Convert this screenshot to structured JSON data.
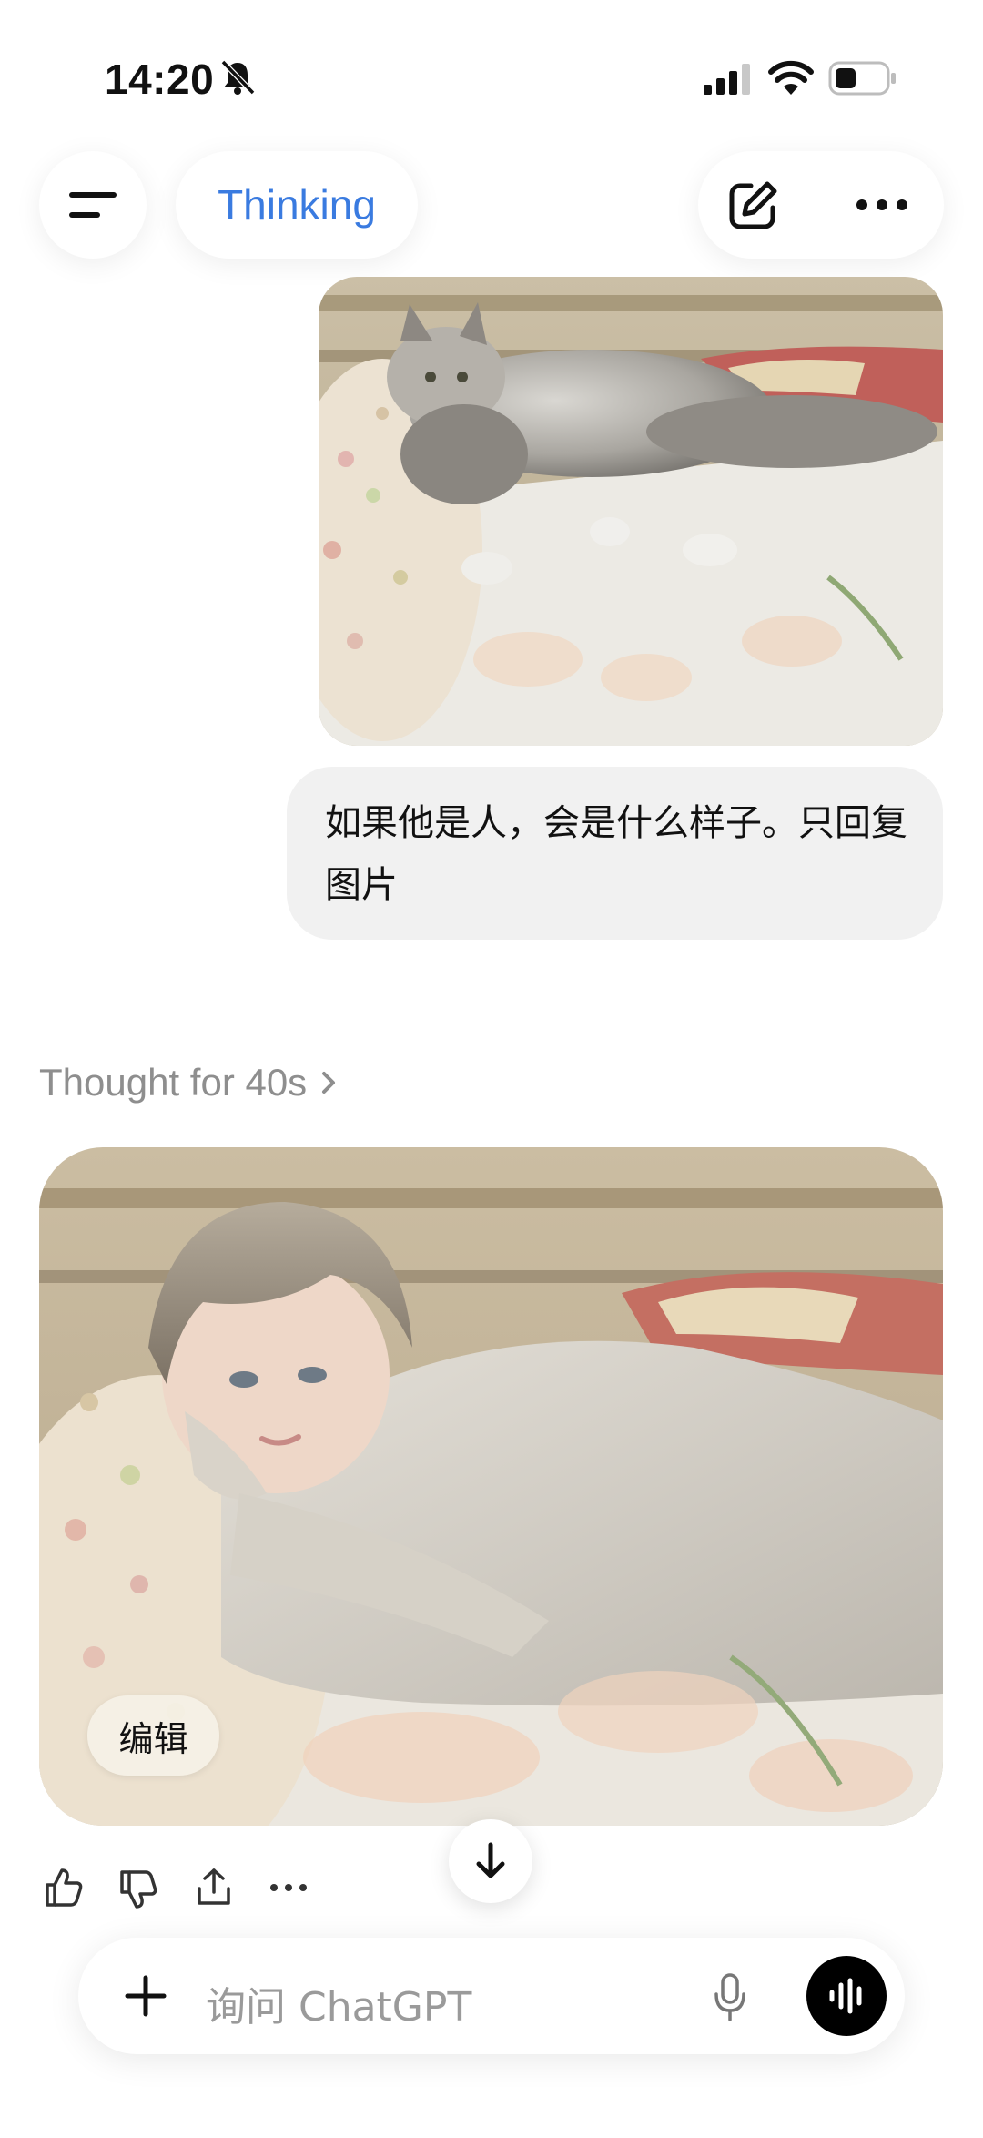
{
  "status_bar": {
    "time": "14:20",
    "icons": [
      "bell-slash-icon",
      "cellular-signal-icon",
      "wifi-icon",
      "battery-icon"
    ]
  },
  "nav": {
    "menu_icon": "menu-icon",
    "model_label": "Thinking",
    "model_color": "#3a7be0",
    "new_chat_icon": "edit-icon",
    "more_icon": "ellipsis-icon"
  },
  "conversation": {
    "user_message": "如果他是人，会是什么样子。只回复图片",
    "thought_label": "Thought for 40s",
    "edit_label": "编辑"
  },
  "feedback": {
    "icons": [
      "thumbs-up-icon",
      "thumbs-down-icon",
      "share-icon",
      "more-icon"
    ]
  },
  "composer": {
    "placeholder": "询问 ChatGPT",
    "icons": [
      "plus-icon",
      "microphone-icon",
      "voice-mode-icon"
    ]
  }
}
